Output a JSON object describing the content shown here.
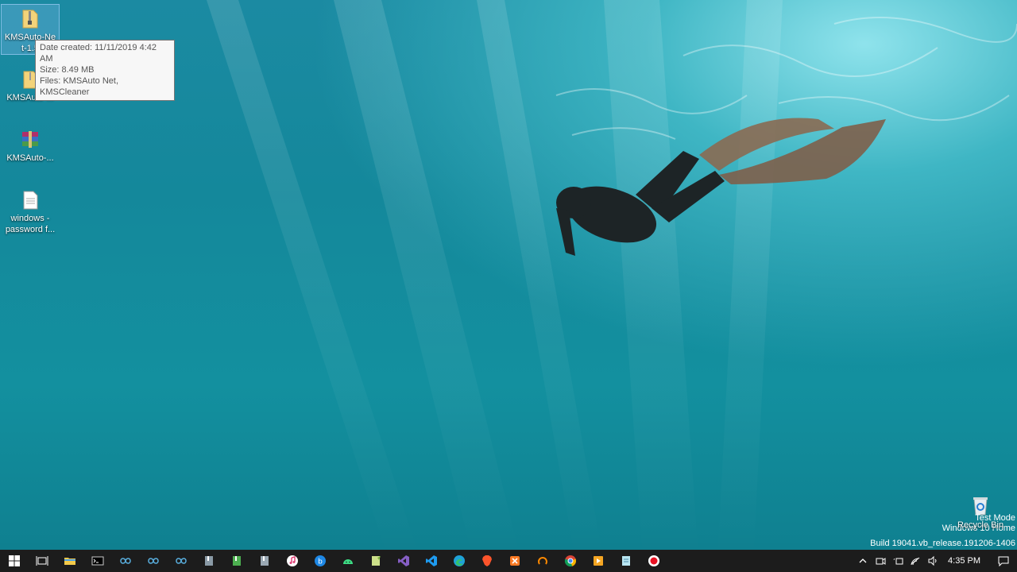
{
  "desktop": {
    "icons": [
      {
        "label": "KMSAuto-Ne t-1.5",
        "icon": "zip-folder-icon"
      },
      {
        "label": "KMSAuto-...",
        "icon": "folder-icon"
      },
      {
        "label": "KMSAuto-...",
        "icon": "winrar-archive-icon"
      },
      {
        "label": "windows - password f...",
        "icon": "text-document-icon"
      }
    ],
    "tooltip": {
      "line1": "Date created: 11/11/2019 4:42 AM",
      "line2": "Size: 8.49 MB",
      "line3": "Files: KMSAuto Net, KMSCleaner"
    },
    "recycle_bin_label": "Recycle Bin",
    "watermark": {
      "line1": "Test Mode",
      "line2": "Windows 10 Home",
      "line3": "Build 19041.vb_release.191206-1406"
    }
  },
  "taskbar": {
    "apps": [
      {
        "name": "start-button",
        "icon": "windows-logo-icon"
      },
      {
        "name": "task-view-button",
        "icon": "task-view-icon"
      },
      {
        "name": "file-explorer",
        "icon": "folder-icon"
      },
      {
        "name": "command-prompt",
        "icon": "terminal-icon"
      },
      {
        "name": "arduino-1",
        "icon": "infinity-icon"
      },
      {
        "name": "arduino-2",
        "icon": "infinity-icon"
      },
      {
        "name": "arduino-3",
        "icon": "infinity-icon"
      },
      {
        "name": "app-gray-1",
        "icon": "file-app-icon"
      },
      {
        "name": "app-green",
        "icon": "file-app-icon"
      },
      {
        "name": "app-gray-2",
        "icon": "file-app-icon"
      },
      {
        "name": "itunes",
        "icon": "music-icon"
      },
      {
        "name": "blue-app",
        "icon": "circle-app-icon"
      },
      {
        "name": "android-studio",
        "icon": "android-icon"
      },
      {
        "name": "notepad-plus",
        "icon": "notepad-icon"
      },
      {
        "name": "visual-studio",
        "icon": "visual-studio-icon"
      },
      {
        "name": "vs-code",
        "icon": "vscode-icon"
      },
      {
        "name": "edge",
        "icon": "edge-icon"
      },
      {
        "name": "brave",
        "icon": "brave-icon"
      },
      {
        "name": "xampp",
        "icon": "xampp-icon"
      },
      {
        "name": "orange-app",
        "icon": "circle-app-icon"
      },
      {
        "name": "chrome",
        "icon": "chrome-icon"
      },
      {
        "name": "media-player",
        "icon": "play-icon"
      },
      {
        "name": "notepad-app",
        "icon": "notepad-icon"
      },
      {
        "name": "screen-recorder",
        "icon": "record-icon"
      }
    ],
    "clock": "4:35 PM"
  },
  "colors": {
    "taskbar": "#1c1c1c",
    "water": "#13909f",
    "accent_green": "#3ddc84",
    "accent_purple": "#865fc5",
    "accent_blue": "#0078d7",
    "record_red": "#e81123"
  }
}
